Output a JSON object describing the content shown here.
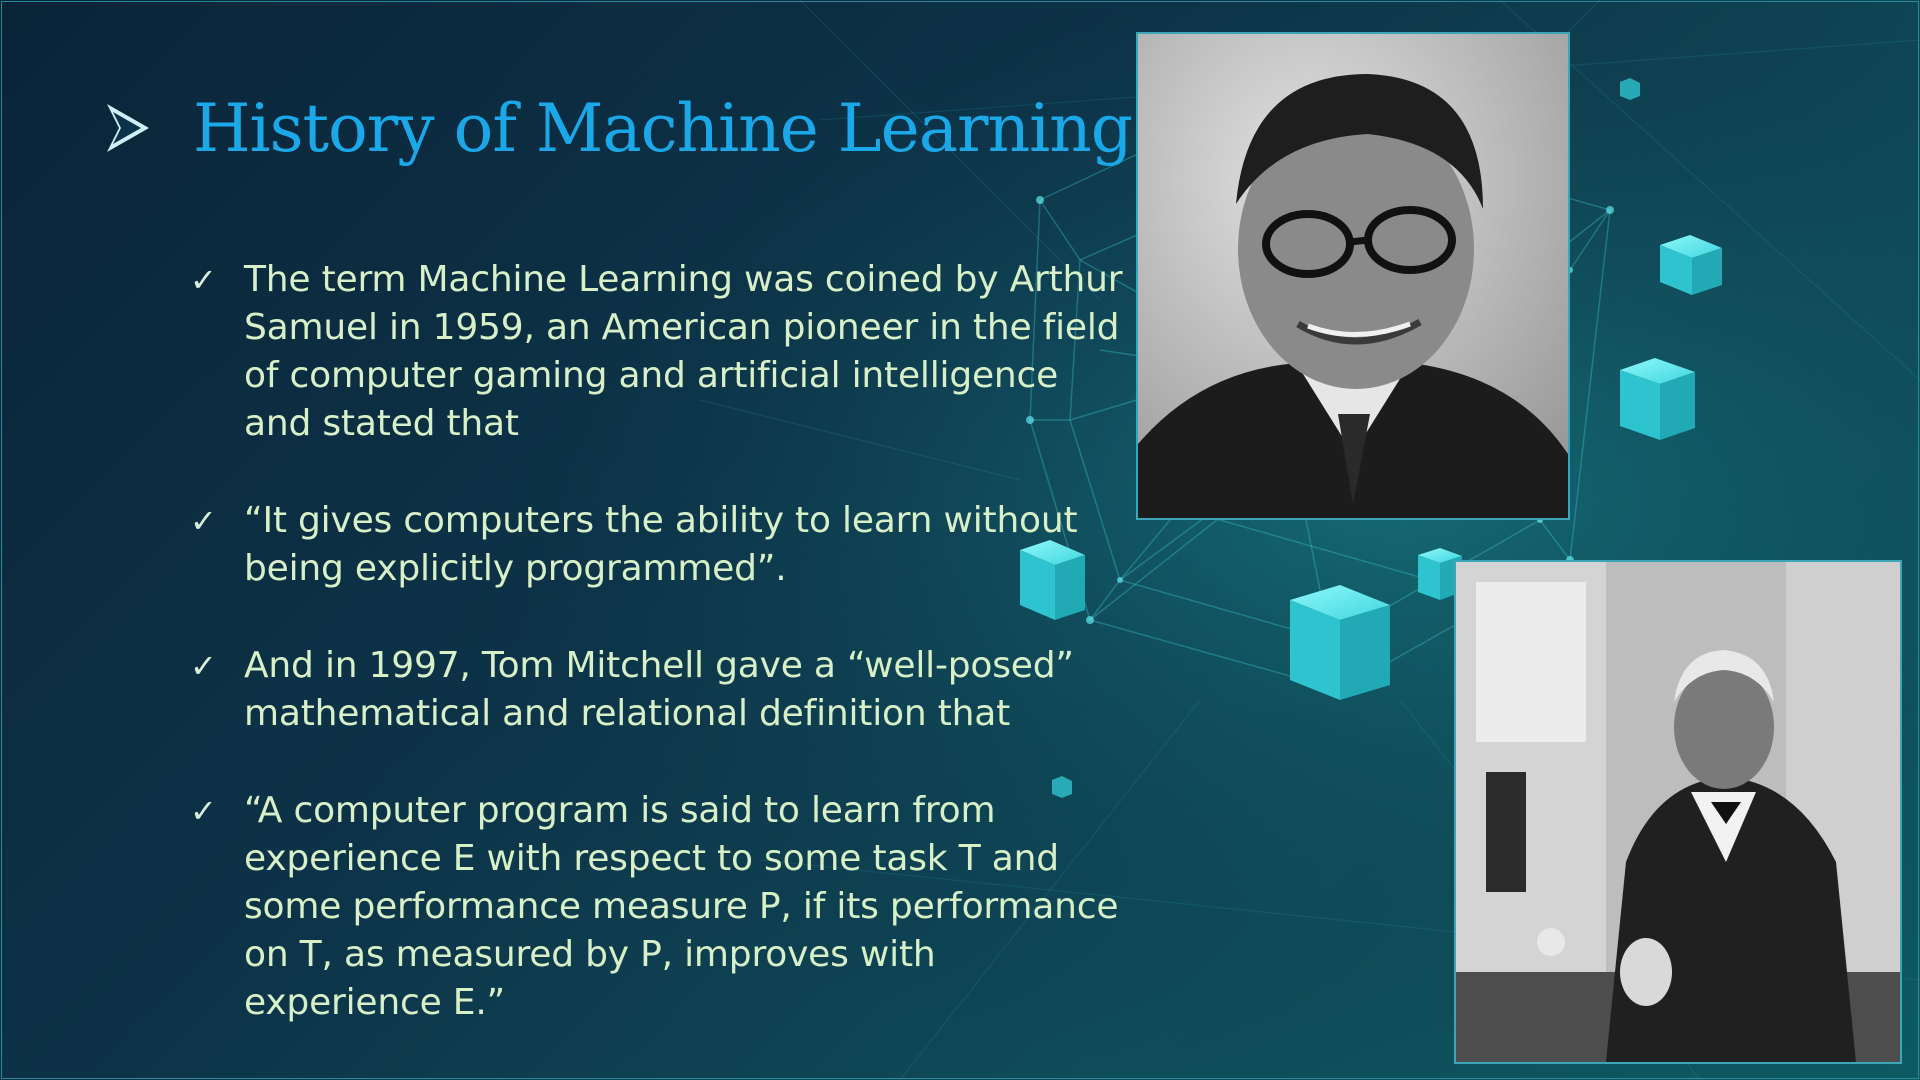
{
  "slide": {
    "title": "History of Machine Learning",
    "title_icon": "arrow-bullet-icon",
    "bullet_icon": "check-icon",
    "bullets": [
      {
        "text": "The term Machine Learning was coined by Arthur Samuel in 1959, an American pioneer in the field of computer gaming and artificial intelligence and stated that"
      },
      {
        "text": "“It gives computers the ability to learn without being explicitly programmed”."
      },
      {
        "text": "And in 1997, Tom Mitchell gave a “well-posed” mathematical and relational definition that"
      },
      {
        "text": "“A computer program is said to learn from experience E with respect to some task T and some performance measure P, if its performance on T, as measured by P, improves with experience E.”"
      }
    ],
    "colors": {
      "title": "#1aa8e8",
      "body_text": "#d8f0c8",
      "background": "#0d3348",
      "accent": "#3ee0e8"
    }
  }
}
